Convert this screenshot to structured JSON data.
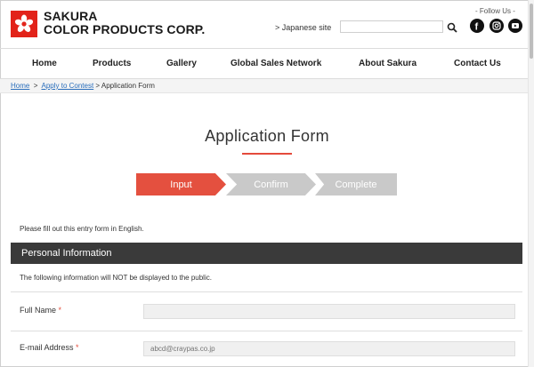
{
  "header": {
    "logo_line1": "SAKURA",
    "logo_line2": "COLOR PRODUCTS CORP.",
    "japanese_site": "> Japanese site",
    "search_placeholder": "",
    "follow_label": "- Follow Us -",
    "social_icons": [
      "facebook-icon",
      "instagram-icon",
      "youtube-icon"
    ]
  },
  "nav": {
    "items": [
      "Home",
      "Products",
      "Gallery",
      "Global Sales Network",
      "About Sakura",
      "Contact Us"
    ]
  },
  "breadcrumb": {
    "home": "Home",
    "sep1": ">",
    "apply": "Apply to Contest",
    "sep2": ">",
    "current": "Application Form"
  },
  "page": {
    "title": "Application Form",
    "steps": [
      "Input",
      "Confirm",
      "Complete"
    ],
    "intro": "Please fill out this entry form in English.",
    "section_title": "Personal Information",
    "section_note": "The following information will NOT be displayed to the public."
  },
  "form": {
    "full_name_label": "Full Name",
    "email_label": "E-mail Address",
    "required_mark": "*",
    "email_placeholder": "abcd@craypas.co.jp"
  },
  "colors": {
    "brand_red": "#e2231a",
    "step_active": "#e4503f",
    "step_inactive": "#c9c9c9",
    "section_bar": "#3a3a3a",
    "link": "#2a6ebb"
  }
}
